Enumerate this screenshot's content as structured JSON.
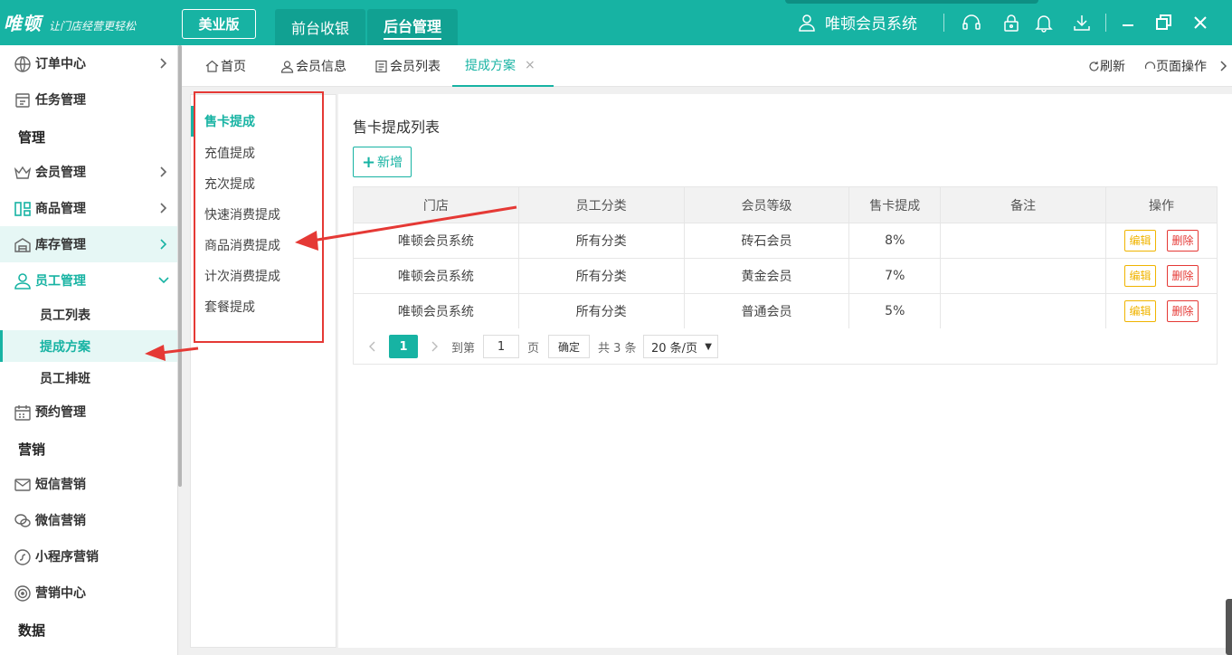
{
  "header": {
    "logo_main": "唯顿",
    "logo_slogan": "让门店经营更轻松",
    "edition": "美业版",
    "nav": [
      "前台收银",
      "后台管理"
    ],
    "system_name": "唯顿会员系统",
    "icons": [
      "user-icon",
      "headset-icon",
      "lock-icon",
      "bell-icon",
      "download-icon",
      "minimize-icon",
      "restore-icon",
      "close-icon"
    ]
  },
  "sidebar": {
    "items": [
      {
        "label": "订单中心",
        "icon": "globe-icon"
      },
      {
        "label": "任务管理",
        "icon": "task-icon"
      },
      {
        "label": "会员管理",
        "icon": "crown-icon"
      },
      {
        "label": "商品管理",
        "icon": "goods-icon"
      },
      {
        "label": "库存管理",
        "icon": "warehouse-icon"
      },
      {
        "label": "员工管理",
        "icon": "person-icon"
      },
      {
        "label": "预约管理",
        "icon": "calendar-icon"
      },
      {
        "label": "短信营销",
        "icon": "mail-icon"
      },
      {
        "label": "微信营销",
        "icon": "wechat-icon"
      },
      {
        "label": "小程序营销",
        "icon": "miniprogram-icon"
      },
      {
        "label": "营销中心",
        "icon": "target-icon"
      }
    ],
    "groups": [
      "管理",
      "营销",
      "数据"
    ],
    "sub_items": [
      "员工列表",
      "提成方案",
      "员工排班"
    ]
  },
  "tabs": {
    "items": [
      "首页",
      "会员信息",
      "会员列表",
      "提成方案"
    ],
    "close": "×",
    "refresh": "刷新",
    "page_ops": "页面操作"
  },
  "commission_menu": [
    "售卡提成",
    "充值提成",
    "充次提成",
    "快速消费提成",
    "商品消费提成",
    "计次消费提成",
    "套餐提成"
  ],
  "main": {
    "title": "售卡提成列表",
    "add_icon": "+",
    "add_label": "新增",
    "columns": [
      "门店",
      "员工分类",
      "会员等级",
      "售卡提成",
      "备注",
      "操作"
    ],
    "rows": [
      {
        "store": "唯顿会员系统",
        "category": "所有分类",
        "level": "砖石会员",
        "rate": "8%",
        "note": ""
      },
      {
        "store": "唯顿会员系统",
        "category": "所有分类",
        "level": "黄金会员",
        "rate": "7%",
        "note": ""
      },
      {
        "store": "唯顿会员系统",
        "category": "所有分类",
        "level": "普通会员",
        "rate": "5%",
        "note": ""
      }
    ],
    "edit_label": "编辑",
    "delete_label": "删除"
  },
  "pagination": {
    "current": "1",
    "goto_label": "到第",
    "goto_value": "1",
    "page_unit": "页",
    "confirm": "确定",
    "total": "共 3 条",
    "page_size": "20 条/页"
  },
  "colors": {
    "accent": "#17b3a3",
    "annotation": "#e53935",
    "edit": "#f0b400"
  }
}
